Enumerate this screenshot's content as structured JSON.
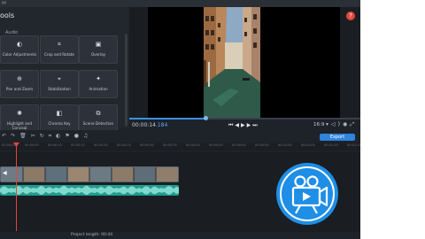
{
  "app": {
    "title_fragment": "pp"
  },
  "tools_panel": {
    "title": "ools",
    "tab": "Audio",
    "items": [
      {
        "label": "Color Adjustments",
        "icon": "color-adjust-icon"
      },
      {
        "label": "Crop and Rotate",
        "icon": "crop-icon"
      },
      {
        "label": "Overlay",
        "icon": "overlay-icon"
      },
      {
        "label": "Pan and Zoom",
        "icon": "zoom-icon"
      },
      {
        "label": "Stabilization",
        "icon": "stabilization-icon"
      },
      {
        "label": "Animation",
        "icon": "animation-icon"
      },
      {
        "label": "Highlight and Conceal",
        "icon": "highlight-icon"
      },
      {
        "label": "Chroma Key",
        "icon": "chroma-key-icon"
      },
      {
        "label": "Scene Detection",
        "icon": "scene-detection-icon"
      }
    ]
  },
  "player": {
    "timecode_main": "00:00:14",
    "timecode_frac": ".184",
    "progress_fraction": 0.33,
    "aspect_ratio": "16:9"
  },
  "toolbar": {
    "export_label": "Export"
  },
  "timeline": {
    "ruler_labels": [
      "00:00:00",
      "00:00:05",
      "00:00:10",
      "00:00:15",
      "00:00:20",
      "00:00:25",
      "00:00:30",
      "00:00:35",
      "00:00:40",
      "00:00:45",
      "00:00:50",
      "00:00:55",
      "00:01:00",
      "00:01:05",
      "00:01:10",
      "00:01:15"
    ]
  },
  "status": {
    "project_length": "Project length: 00:44"
  },
  "colors": {
    "accent": "#2f84dc",
    "playhead": "#e2473a",
    "audio": "#1f9c8e",
    "logo": "#1e8ee6"
  }
}
